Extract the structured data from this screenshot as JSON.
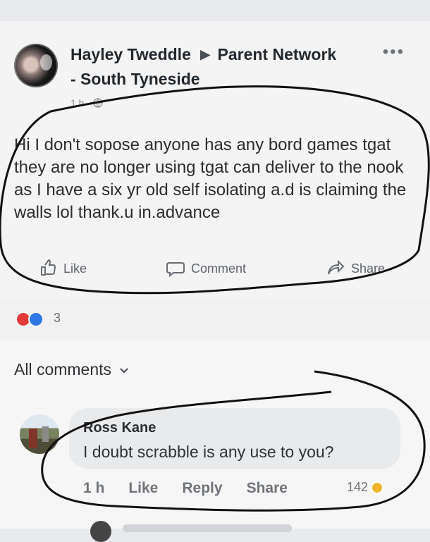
{
  "post": {
    "author": "Hayley Tweddle",
    "arrow": "▶",
    "group": "Parent Network",
    "group_suffix": "- South Tyneside",
    "time": "1 h ·",
    "more": "•••",
    "text": "Hi I don't sopose anyone has any bord games tgat they are no longer using tgat can deliver to the nook as I have a six yr old self isolating a.d is claiming the walls lol  thank.u in.advance",
    "actions": {
      "like": "Like",
      "comment": "Comment",
      "share": "Share"
    },
    "reaction_count": "3"
  },
  "comments": {
    "label": "All comments",
    "items": [
      {
        "name": "Ross Kane",
        "text": "I doubt scrabble is any use to you?",
        "time": "1 h",
        "like": "Like",
        "reply": "Reply",
        "share": "Share",
        "count": "142"
      }
    ]
  }
}
